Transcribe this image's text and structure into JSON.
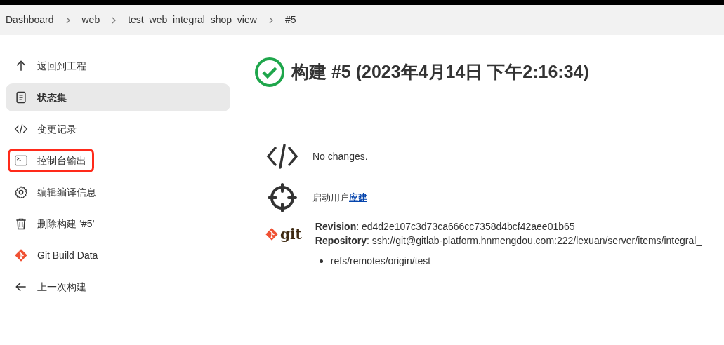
{
  "breadcrumbs": [
    {
      "label": "Dashboard"
    },
    {
      "label": "web"
    },
    {
      "label": "test_web_integral_shop_view"
    },
    {
      "label": "#5"
    }
  ],
  "sidebar": {
    "items": [
      {
        "kind": "up",
        "label": "返回到工程",
        "selected": false,
        "highlighted": false
      },
      {
        "kind": "document",
        "label": "状态集",
        "selected": true,
        "highlighted": false
      },
      {
        "kind": "code",
        "label": "变更记录",
        "selected": false,
        "highlighted": false
      },
      {
        "kind": "terminal",
        "label": "控制台输出",
        "selected": false,
        "highlighted": true
      },
      {
        "kind": "gear",
        "label": "编辑编译信息",
        "selected": false,
        "highlighted": false
      },
      {
        "kind": "trash",
        "label": "删除构建 ‘#5’",
        "selected": false,
        "highlighted": false
      },
      {
        "kind": "git",
        "label": "Git Build Data",
        "selected": false,
        "highlighted": false
      },
      {
        "kind": "left",
        "label": "上一次构建",
        "selected": false,
        "highlighted": false
      }
    ]
  },
  "build": {
    "success": true,
    "title": "构建 #5 (2023年4月14日 下午2:16:34)"
  },
  "changes": {
    "text": "No changes."
  },
  "started_by": {
    "text": "启动用户",
    "user": "应建"
  },
  "git": {
    "logo_text": "git",
    "revision_label": "Revision",
    "revision": ": ed4d2e107c3d73ca666cc7358d4bcf42aee01b65",
    "repository_label": "Repository",
    "repository": ": ssh://git@gitlab-platform.hnmengdou.com:222/lexuan/server/items/integral_",
    "refs": [
      "refs/remotes/origin/test"
    ]
  }
}
